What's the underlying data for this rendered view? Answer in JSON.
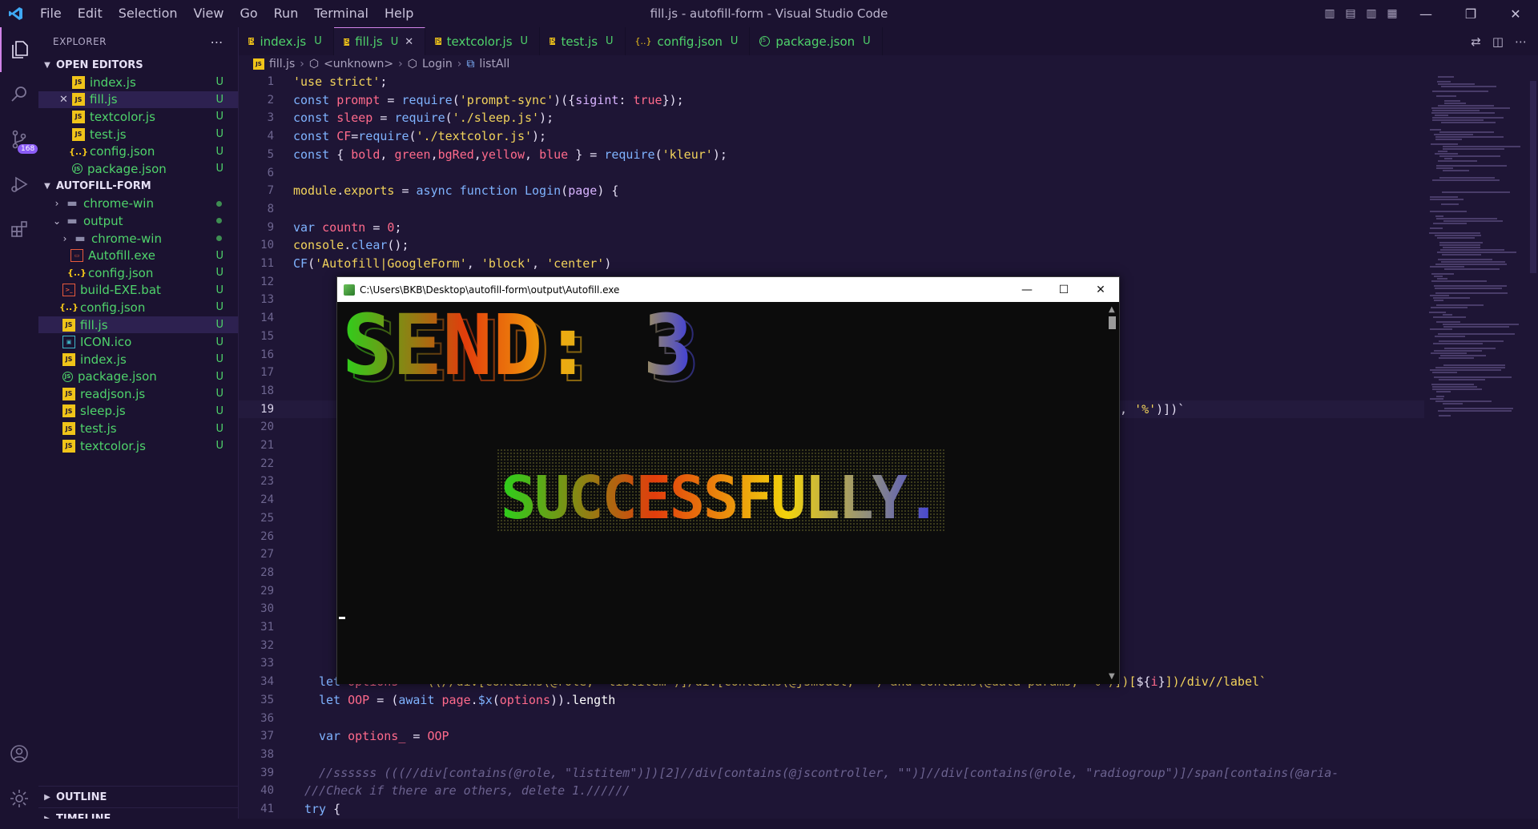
{
  "titlebar": {
    "menu": [
      "File",
      "Edit",
      "Selection",
      "View",
      "Go",
      "Run",
      "Terminal",
      "Help"
    ],
    "title": "fill.js - autofill-form - Visual Studio Code"
  },
  "activity": {
    "scm_badge": "168"
  },
  "explorer": {
    "header": "EXPLORER",
    "open_editors_label": "OPEN EDITORS",
    "open_editors": [
      {
        "name": "index.js",
        "status": "U",
        "type": "js"
      },
      {
        "name": "fill.js",
        "status": "U",
        "type": "js"
      },
      {
        "name": "textcolor.js",
        "status": "U",
        "type": "js"
      },
      {
        "name": "test.js",
        "status": "U",
        "type": "js"
      },
      {
        "name": "config.json",
        "status": "U",
        "type": "json"
      },
      {
        "name": "package.json",
        "status": "U",
        "type": "pkg"
      }
    ],
    "project_label": "AUTOFILL-FORM",
    "tree": [
      {
        "name": "chrome-win",
        "depth": 0,
        "kind": "folder-closed"
      },
      {
        "name": "output",
        "depth": 0,
        "kind": "folder-open"
      },
      {
        "name": "chrome-win",
        "depth": 1,
        "kind": "folder-closed"
      },
      {
        "name": "Autofill.exe",
        "depth": 1,
        "kind": "exe",
        "status": "U"
      },
      {
        "name": "config.json",
        "depth": 1,
        "kind": "json",
        "status": "U"
      },
      {
        "name": "build-EXE.bat",
        "depth": 0,
        "kind": "bat",
        "status": "U"
      },
      {
        "name": "config.json",
        "depth": 0,
        "kind": "json",
        "status": "U"
      },
      {
        "name": "fill.js",
        "depth": 0,
        "kind": "js",
        "status": "U"
      },
      {
        "name": "ICON.ico",
        "depth": 0,
        "kind": "ico",
        "status": "U"
      },
      {
        "name": "index.js",
        "depth": 0,
        "kind": "js",
        "status": "U"
      },
      {
        "name": "package.json",
        "depth": 0,
        "kind": "pkg",
        "status": "U"
      },
      {
        "name": "readjson.js",
        "depth": 0,
        "kind": "js",
        "status": "U"
      },
      {
        "name": "sleep.js",
        "depth": 0,
        "kind": "js",
        "status": "U"
      },
      {
        "name": "test.js",
        "depth": 0,
        "kind": "js",
        "status": "U"
      },
      {
        "name": "textcolor.js",
        "depth": 0,
        "kind": "js",
        "status": "U"
      }
    ],
    "outline_label": "OUTLINE",
    "timeline_label": "TIMELINE"
  },
  "tabs": [
    {
      "name": "index.js",
      "status": "U",
      "type": "js"
    },
    {
      "name": "fill.js",
      "status": "U",
      "type": "js"
    },
    {
      "name": "textcolor.js",
      "status": "U",
      "type": "js"
    },
    {
      "name": "test.js",
      "status": "U",
      "type": "js"
    },
    {
      "name": "config.json",
      "status": "U",
      "type": "json"
    },
    {
      "name": "package.json",
      "status": "U",
      "type": "pkg"
    }
  ],
  "breadcrumb": [
    "fill.js",
    "<unknown>",
    "Login",
    "listAll"
  ],
  "console": {
    "title": "C:\\Users\\BKB\\Desktop\\autofill-form\\output\\Autofill.exe",
    "banner_send": "SEND: 3",
    "banner_success": "SUCCESSFULLY."
  },
  "colors": {
    "accent": "#d183e8",
    "untracked": "#4fd36b",
    "editor_bg": "#1e1535"
  }
}
